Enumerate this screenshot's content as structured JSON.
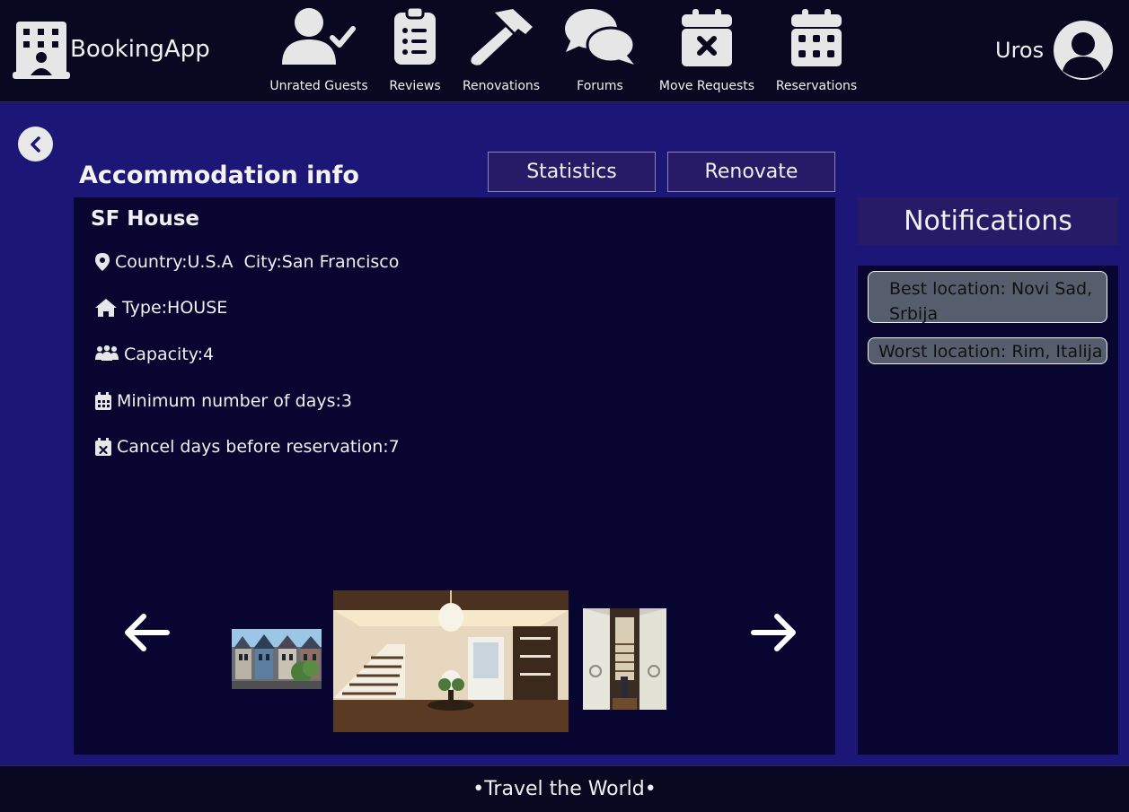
{
  "header": {
    "app_name": "BookingApp",
    "nav": [
      {
        "label": "Unrated Guests",
        "icon": "user-check-icon"
      },
      {
        "label": "Reviews",
        "icon": "clipboard-list-icon"
      },
      {
        "label": "Renovations",
        "icon": "hammer-icon"
      },
      {
        "label": "Forums",
        "icon": "comments-icon"
      },
      {
        "label": "Move Requests",
        "icon": "calendar-x-icon"
      },
      {
        "label": "Reservations",
        "icon": "calendar-grid-icon"
      }
    ],
    "user_name": "Uros"
  },
  "main": {
    "title": "Accommodation info",
    "statistics_label": "Statistics",
    "renovate_label": "Renovate",
    "accommodation": {
      "name": "SF House",
      "country": "Country:U.S.A",
      "city": "City:San Francisco",
      "type": "Type:HOUSE",
      "capacity": "Capacity:4",
      "min_days": "Minimum number of days:3",
      "cancel_days": "Cancel days before reservation:7"
    }
  },
  "notifications": {
    "title": "Notifications",
    "items": [
      "Best location: Novi Sad, Srbija",
      "Worst location: Rim, Italija"
    ]
  },
  "footer": {
    "text": "•Travel the World•"
  },
  "colors": {
    "page_bg": "#1c1776",
    "bar_bg": "#0a0820",
    "panel_bg": "#080631",
    "button_bg": "#271a66",
    "notification_bg": "#565e6d"
  }
}
